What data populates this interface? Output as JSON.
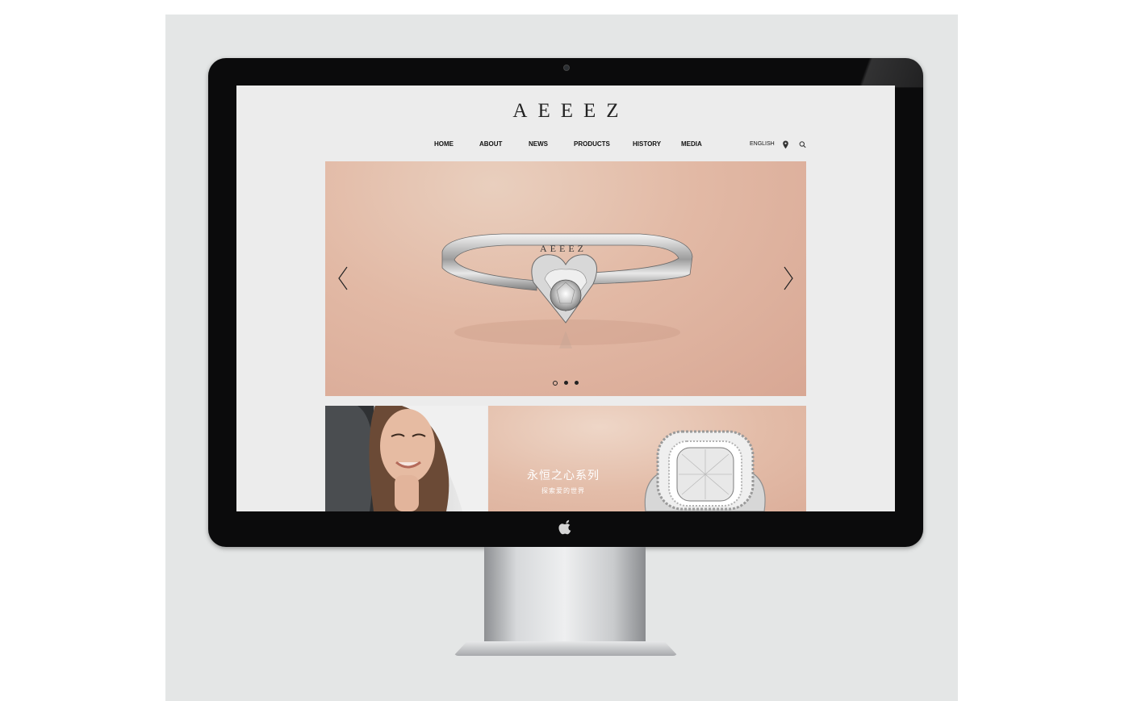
{
  "site": {
    "brand": "AEEEZ"
  },
  "nav": {
    "items": [
      {
        "label": "HOME"
      },
      {
        "label": "ABOUT"
      },
      {
        "label": "NEWS"
      },
      {
        "label": "PRODUCTS"
      },
      {
        "label": "HISTORY"
      },
      {
        "label": "MEDIA"
      }
    ],
    "language": "ENGLISH",
    "location_icon": "map-pin-icon",
    "search_icon": "search-icon"
  },
  "hero": {
    "ring_engraving": "AEEEZ",
    "prev_icon": "chevron-left-icon",
    "next_icon": "chevron-right-icon",
    "slides_total": 3,
    "active_slide": 1
  },
  "promo": {
    "title": "永恒之心系列",
    "subtitle": "探索爱的世界"
  },
  "colors": {
    "hero_bg": "#dfb3a0",
    "screen_bg": "#ececec",
    "bezel": "#0b0b0c",
    "backdrop": "#e4e6e6"
  }
}
